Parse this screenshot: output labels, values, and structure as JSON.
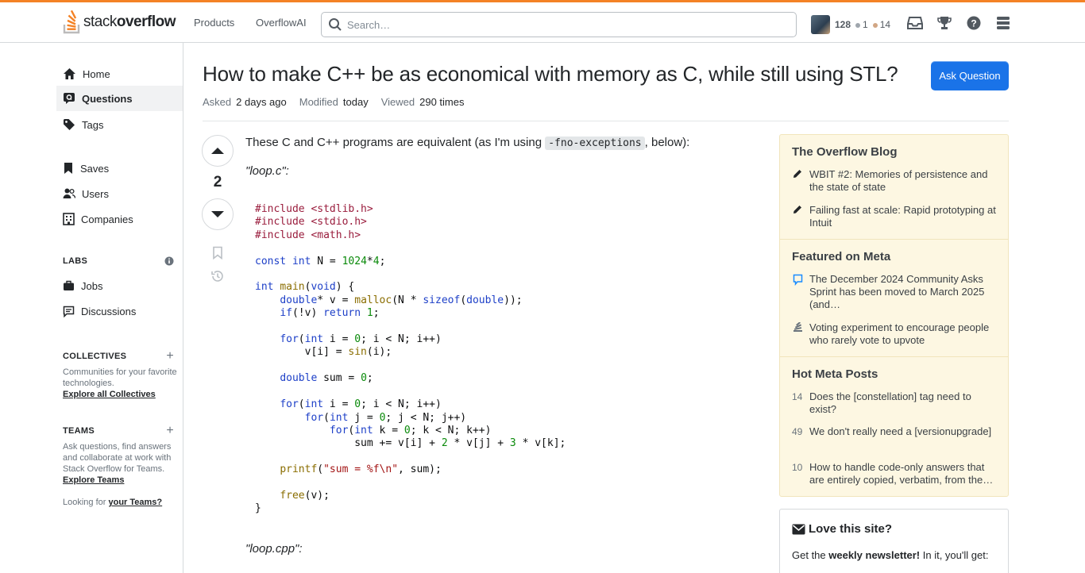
{
  "header": {
    "logo_text_light": "stack",
    "logo_text_bold": "overflow",
    "nav": [
      "Products",
      "OverflowAI"
    ],
    "search_placeholder": "Search…",
    "reputation": "128",
    "silver_badges": "1",
    "bronze_badges": "14",
    "colors": {
      "accent": "#f48225",
      "silver": "#9fa6ad",
      "bronze": "#d1a684"
    }
  },
  "sidebar": {
    "items": [
      "Home",
      "Questions",
      "Tags",
      "Saves",
      "Users",
      "Companies"
    ],
    "labs_heading": "LABS",
    "labs_items": [
      "Jobs",
      "Discussions"
    ],
    "collectives_heading": "COLLECTIVES",
    "collectives_text": "Communities for your favorite technologies.",
    "collectives_link": "Explore all Collectives",
    "teams_heading": "TEAMS",
    "teams_text": "Ask questions, find answers and collaborate at work with Stack Overflow for Teams.",
    "teams_link": "Explore Teams",
    "looking_for": "Looking for",
    "teams_link2": "your Teams?"
  },
  "question": {
    "title": "How to make C++ be as economical with memory as C, while still using STL?",
    "ask_button": "Ask Question",
    "asked_label": "Asked",
    "asked_value": "2 days ago",
    "modified_label": "Modified",
    "modified_value": "today",
    "viewed_label": "Viewed",
    "viewed_value": "290 times",
    "votes": "2",
    "intro_before": "These C and C++ programs are equivalent (as I'm using ",
    "intro_code": "-fno-exceptions",
    "intro_after": ", below):",
    "file1": "\"loop.c\":",
    "file2": "\"loop.cpp\":"
  },
  "blog": {
    "heading": "The Overflow Blog",
    "items": [
      "WBIT #2: Memories of persistence and the state of state",
      "Failing fast at scale: Rapid prototyping at Intuit"
    ]
  },
  "meta_featured": {
    "heading": "Featured on Meta",
    "items": [
      "The December 2024 Community Asks Sprint has been moved to March 2025 (and…",
      "Voting experiment to encourage people who rarely vote to upvote"
    ]
  },
  "hot_meta": {
    "heading": "Hot Meta Posts",
    "items": [
      {
        "count": "14",
        "text": "Does the [constellation] tag need to exist?"
      },
      {
        "count": "49",
        "text": "We don't really need a [versionupgrade]"
      },
      {
        "count": "10",
        "text": "How to handle code-only answers that are entirely copied, verbatim, from the…"
      }
    ]
  },
  "love": {
    "heading": "Love this site?",
    "text_before": "Get the ",
    "text_bold": "weekly newsletter!",
    "text_after": " In it, you'll get:"
  }
}
